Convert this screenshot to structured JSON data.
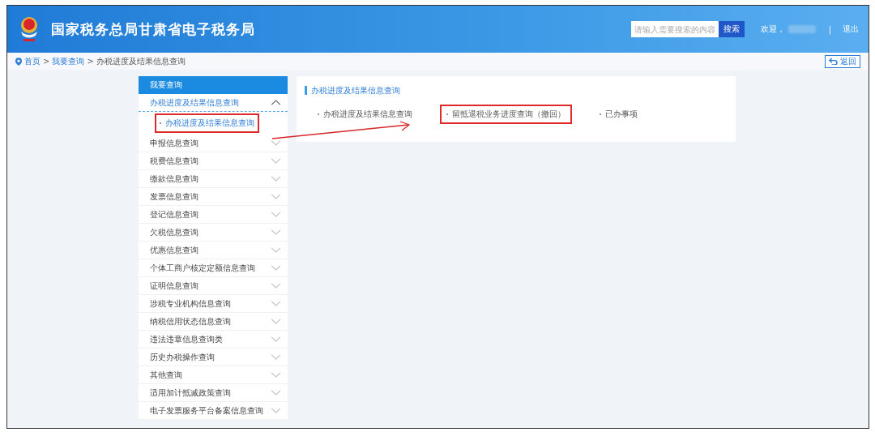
{
  "header": {
    "title": "国家税务总局甘肃省电子税务局",
    "search": {
      "placeholder": "请输入需要搜索的内容"
    },
    "search_button": "搜索",
    "welcome": "欢迎，",
    "separator": "|",
    "logout": "退出"
  },
  "breadcrumb": {
    "items": [
      "首页",
      "我要查询",
      "办税进度及结果信息查询"
    ],
    "separator": ">"
  },
  "back_button": "返回",
  "sidebar": {
    "title": "我要查询",
    "items": [
      {
        "label": "办税进度及结果信息查询",
        "expanded": true,
        "children": [
          {
            "label": "办税进度及结果信息查询",
            "highlighted": true
          }
        ]
      },
      {
        "label": "申报信息查询",
        "expanded": false
      },
      {
        "label": "税费信息查询",
        "expanded": false
      },
      {
        "label": "缴款信息查询",
        "expanded": false
      },
      {
        "label": "发票信息查询",
        "expanded": false
      },
      {
        "label": "登记信息查询",
        "expanded": false
      },
      {
        "label": "欠税信息查询",
        "expanded": false
      },
      {
        "label": "优惠信息查询",
        "expanded": false
      },
      {
        "label": "个体工商户核定定额信息查询",
        "expanded": false
      },
      {
        "label": "证明信息查询",
        "expanded": false
      },
      {
        "label": "涉税专业机构信息查询",
        "expanded": false
      },
      {
        "label": "纳税信用状态信息查询",
        "expanded": false
      },
      {
        "label": "违法违章信息查询类",
        "expanded": false
      },
      {
        "label": "历史办税操作查询",
        "expanded": false
      },
      {
        "label": "其他查询",
        "expanded": false
      },
      {
        "label": "适用加计抵减政策查询",
        "expanded": false
      },
      {
        "label": "电子发票服务平台备案信息查询",
        "expanded": false
      }
    ]
  },
  "panel": {
    "title": "办税进度及结果信息查询",
    "links": [
      {
        "label": "办税进度及结果信息查询",
        "highlighted": false
      },
      {
        "label": "留抵退税业务进度查询（撤回）",
        "highlighted": true
      },
      {
        "label": "已办事项",
        "highlighted": false
      }
    ]
  }
}
